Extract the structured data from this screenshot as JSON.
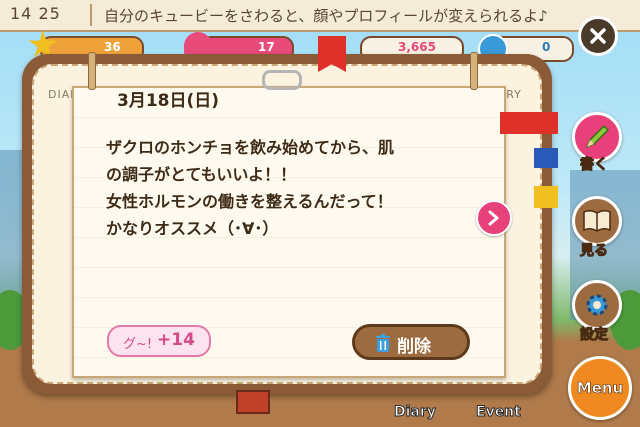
{
  "ticker": {
    "time": "14 25",
    "message": "自分のキュービーをさわると、顔やプロフィールが変えられるよ♪"
  },
  "status": {
    "stat1": "36",
    "stat2": "17",
    "stat3": "3,665",
    "stat4": "0"
  },
  "notebook": {
    "left_label": "DIARY",
    "right_label": "DIARY"
  },
  "entry": {
    "date": "3月18日(日)",
    "lines": [
      "ザクロのホンチョを飲み始めてから、肌",
      "の調子がとてもいいよ！！",
      "女性ホルモンの働きを整えるんだって！",
      "かなりオススメ（･∀･）"
    ],
    "like_prefix": "グ~!",
    "like_count": "+14",
    "delete_label": "削除"
  },
  "side_menu": {
    "write": "書く",
    "view": "見る",
    "settings": "設定",
    "menu": "Menu"
  },
  "bottom": {
    "diary": "Diary",
    "event": "Event"
  },
  "colors": {
    "accent_pink": "#e8407a",
    "brown": "#8b5a36",
    "menu_orange": "#f08a20"
  },
  "icons": {
    "close": "close-icon",
    "next": "chevron-right-icon",
    "trash": "trash-icon",
    "pencil": "pencil-icon",
    "book": "book-icon",
    "gear": "gear-icon"
  }
}
